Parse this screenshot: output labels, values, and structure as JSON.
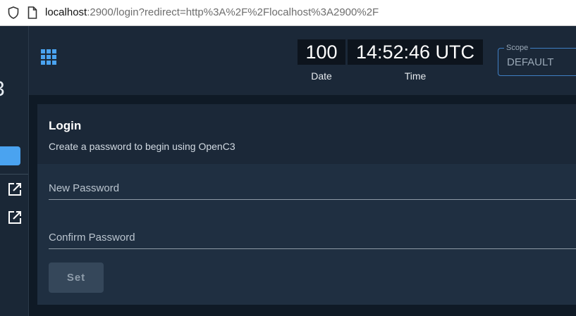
{
  "browser": {
    "url_host": "localhost",
    "url_path": ":2900/login?redirect=http%3A%2F%2Flocalhost%3A2900%2F"
  },
  "nav": {
    "logo_glyph": "3",
    "icons": [
      "apps-icon",
      "external-link-icon",
      "external-link-icon"
    ]
  },
  "clock": {
    "date_value": "100",
    "date_label": "Date",
    "time_value": "14:52:46 UTC",
    "time_label": "Time"
  },
  "scope": {
    "label": "Scope",
    "value": "DEFAULT"
  },
  "login": {
    "title": "Login",
    "subtitle": "Create a password to begin using OpenC3",
    "new_password_placeholder": "New Password",
    "confirm_password_placeholder": "Confirm Password",
    "set_label": "Set"
  },
  "colors": {
    "accent": "#4aa3f0",
    "background": "#0f1a26",
    "panel": "#1b2838",
    "button_disabled": "#35475a"
  }
}
